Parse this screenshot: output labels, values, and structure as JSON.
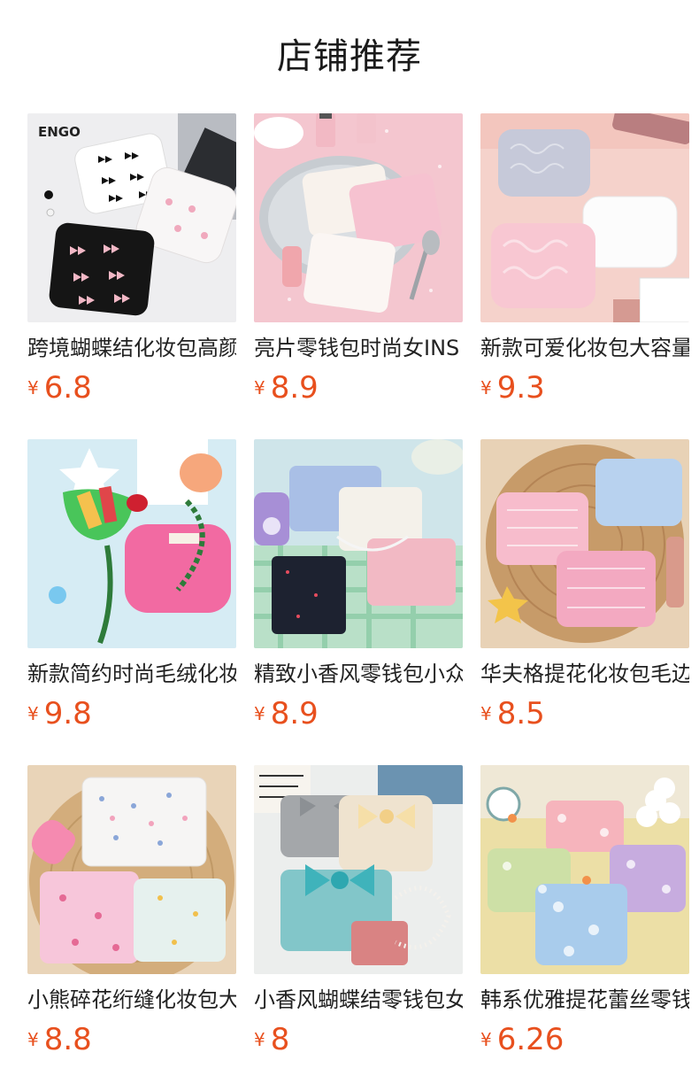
{
  "section": {
    "title": "店铺推荐"
  },
  "products": [
    {
      "name": "跨境蝴蝶结化妆包高颜值",
      "currency": "¥",
      "price": "6.8",
      "image": {
        "icon": "bow-pattern-pouch-photo",
        "bg": "#f1f1f3",
        "colors": [
          "#ffffff",
          "#1a1a1a",
          "#f7f4f4",
          "#f2b8c6"
        ],
        "logo": "ENGO"
      }
    },
    {
      "name": "亮片零钱包时尚女INS",
      "currency": "¥",
      "price": "8.9",
      "image": {
        "icon": "sequin-coin-purse-photo",
        "bg": "#f4c9cf",
        "colors": [
          "#f7f1ec",
          "#f6c6d2",
          "#faf5f2",
          "#bfc4c9"
        ]
      }
    },
    {
      "name": "新款可爱化妆包大容量",
      "currency": "¥",
      "price": "9.3",
      "image": {
        "icon": "heart-quilted-pouch-photo",
        "bg": "#f6d3cc",
        "colors": [
          "#c9cbd9",
          "#fbfbfb",
          "#f7c9d3",
          "#e9b8ad"
        ]
      }
    },
    {
      "name": "新款简约时尚毛绒化妆包",
      "currency": "¥",
      "price": "9.8",
      "image": {
        "icon": "plush-pouch-photo",
        "bg": "#d9edf5",
        "colors": [
          "#4ccb5a",
          "#f26ea6",
          "#ffffff",
          "#c8272f"
        ]
      }
    },
    {
      "name": "精致小香风零钱包小众",
      "currency": "¥",
      "price": "8.9",
      "image": {
        "icon": "tweed-coin-purse-photo",
        "bg": "#9fd3b7",
        "colors": [
          "#a9bfe6",
          "#f2efe6",
          "#1d2230",
          "#f0b7c2"
        ]
      }
    },
    {
      "name": "华夫格提花化妆包毛边",
      "currency": "¥",
      "price": "8.5",
      "image": {
        "icon": "waffle-jacquard-pouch-photo",
        "bg": "#e6c9a7",
        "colors": [
          "#f6bccb",
          "#b9d3ef",
          "#f3a8c0",
          "#c89a6e"
        ]
      }
    },
    {
      "name": "小熊碎花绗缝化妆包大",
      "currency": "¥",
      "price": "8.8",
      "image": {
        "icon": "floral-quilted-pouch-photo",
        "bg": "#e3c8a2",
        "colors": [
          "#f5f4f4",
          "#f7c8dc",
          "#e7f1ee",
          "#f28cb0"
        ]
      }
    },
    {
      "name": "小香风蝴蝶结零钱包女",
      "currency": "¥",
      "price": "8",
      "image": {
        "icon": "bow-tweed-coin-purse-photo",
        "bg": "#e9eceb",
        "colors": [
          "#a5a8ab",
          "#efe3cf",
          "#7fc4c8",
          "#4fb9c0"
        ]
      }
    },
    {
      "name": "韩系优雅提花蕾丝零钱包",
      "currency": "¥",
      "price": "6.26",
      "image": {
        "icon": "lace-jacquard-coin-purse-photo",
        "bg": "#ecdfa0",
        "colors": [
          "#f6b6bd",
          "#cde0a6",
          "#c9aee0",
          "#a9ccec"
        ]
      }
    }
  ]
}
